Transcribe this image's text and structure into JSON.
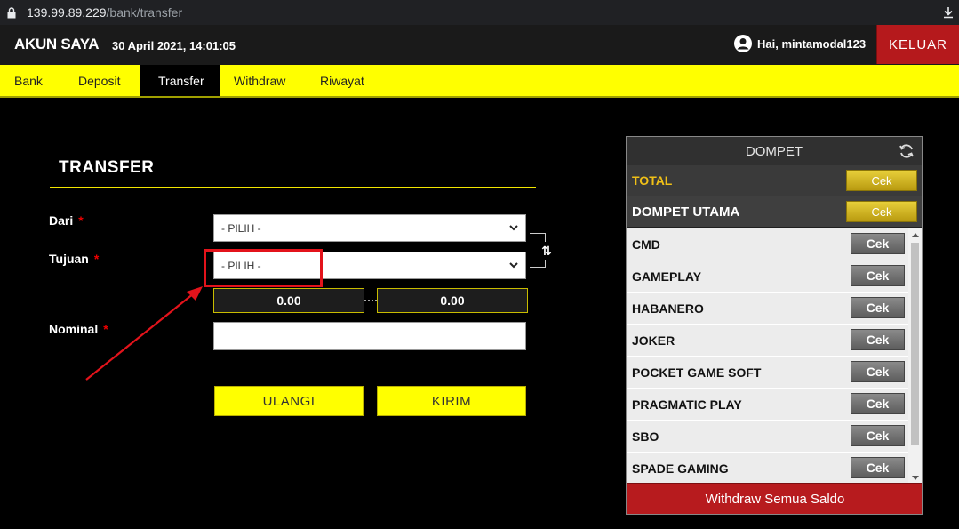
{
  "browser": {
    "host": "139.99.89.229",
    "path": "/bank/transfer"
  },
  "header": {
    "brand": "AKUN SAYA",
    "datetime": "30 April 2021, 14:01:05",
    "greeting": "Hai, mintamodal123",
    "logout_label": "KELUAR"
  },
  "nav": {
    "tabs": [
      {
        "label": "Bank"
      },
      {
        "label": "Deposit"
      },
      {
        "label": "Transfer"
      },
      {
        "label": "Withdraw"
      },
      {
        "label": "Riwayat"
      }
    ],
    "active": "Transfer"
  },
  "transfer": {
    "title": "TRANSFER",
    "from_label": "Dari",
    "to_label": "Tujuan",
    "amount_label": "Nominal",
    "required_mark": "*",
    "from_value": "- PILIH -",
    "to_value": "- PILIH -",
    "from_balance": "0.00",
    "to_balance": "0.00",
    "swap_symbol": "⇅",
    "reset_label": "ULANGI",
    "submit_label": "KIRIM"
  },
  "wallet": {
    "title": "DOMPET",
    "total_label": "TOTAL",
    "main_label": "DOMPET UTAMA",
    "check_label": "Cek",
    "items": [
      {
        "label": "CMD"
      },
      {
        "label": "GAMEPLAY"
      },
      {
        "label": "HABANERO"
      },
      {
        "label": "JOKER"
      },
      {
        "label": "POCKET GAME SOFT"
      },
      {
        "label": "PRAGMATIC PLAY"
      },
      {
        "label": "SBO"
      },
      {
        "label": "SPADE GAMING"
      }
    ],
    "withdraw_all_label": "Withdraw Semua Saldo"
  },
  "colors": {
    "accent_yellow": "#ffff00",
    "danger_red": "#b5191c",
    "gold": "#e7cf3a",
    "annotation_red": "#e3131b"
  }
}
